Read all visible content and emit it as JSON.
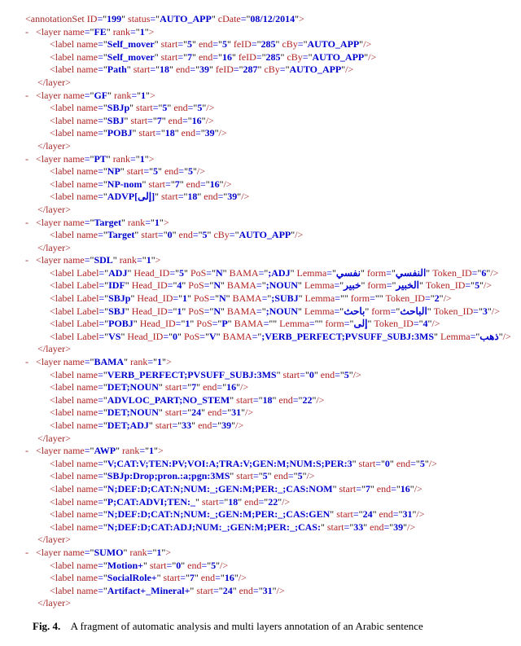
{
  "caption_label": "Fig. 4.",
  "caption_text": "A fragment of automatic analysis and multi layers annotation of an Arabic sentence",
  "annotationSet": {
    "ID": "199",
    "status": "AUTO_APP",
    "cDate": "08/12/2014"
  },
  "layers": [
    {
      "name": "FE",
      "rank": "1",
      "labels": [
        {
          "attrs": [
            [
              "name",
              "Self_mover"
            ],
            [
              "start",
              "5"
            ],
            [
              "end",
              "5"
            ],
            [
              "feID",
              "285"
            ],
            [
              "cBy",
              "AUTO_APP"
            ]
          ]
        },
        {
          "attrs": [
            [
              "name",
              "Self_mover"
            ],
            [
              "start",
              "7"
            ],
            [
              "end",
              "16"
            ],
            [
              "feID",
              "285"
            ],
            [
              "cBy",
              "AUTO_APP"
            ]
          ]
        },
        {
          "attrs": [
            [
              "name",
              "Path"
            ],
            [
              "start",
              "18"
            ],
            [
              "end",
              "39"
            ],
            [
              "feID",
              "287"
            ],
            [
              "cBy",
              "AUTO_APP"
            ]
          ]
        }
      ]
    },
    {
      "name": "GF",
      "rank": "1",
      "labels": [
        {
          "attrs": [
            [
              "name",
              "SBJp"
            ],
            [
              "start",
              "5"
            ],
            [
              "end",
              "5"
            ]
          ]
        },
        {
          "attrs": [
            [
              "name",
              "SBJ"
            ],
            [
              "start",
              "7"
            ],
            [
              "end",
              "16"
            ]
          ]
        },
        {
          "attrs": [
            [
              "name",
              "POBJ"
            ],
            [
              "start",
              "18"
            ],
            [
              "end",
              "39"
            ]
          ]
        }
      ]
    },
    {
      "name": "PT",
      "rank": "1",
      "labels": [
        {
          "attrs": [
            [
              "name",
              "NP"
            ],
            [
              "start",
              "5"
            ],
            [
              "end",
              "5"
            ]
          ]
        },
        {
          "attrs": [
            [
              "name",
              "NP-nom"
            ],
            [
              "start",
              "7"
            ],
            [
              "end",
              "16"
            ]
          ]
        },
        {
          "attrs": [
            [
              "name",
              "ADVP[إلى]"
            ],
            [
              "start",
              "18"
            ],
            [
              "end",
              "39"
            ]
          ]
        }
      ]
    },
    {
      "name": "Target",
      "rank": "1",
      "labels": [
        {
          "attrs": [
            [
              "name",
              "Target"
            ],
            [
              "start",
              "0"
            ],
            [
              "end",
              "5"
            ],
            [
              "cBy",
              "AUTO_APP"
            ]
          ]
        }
      ]
    },
    {
      "name": "SDL",
      "rank": "1",
      "labels": [
        {
          "attrs": [
            [
              "Label",
              "ADJ"
            ],
            [
              "Head_ID",
              "5"
            ],
            [
              "PoS",
              "N"
            ],
            [
              "BAMA",
              ";ADJ"
            ],
            [
              "Lemma",
              "نفسي"
            ],
            [
              "form",
              "النفسي"
            ],
            [
              "Token_ID",
              "6"
            ]
          ]
        },
        {
          "attrs": [
            [
              "Label",
              "IDF"
            ],
            [
              "Head_ID",
              "4"
            ],
            [
              "PoS",
              "N"
            ],
            [
              "BAMA",
              ";NOUN"
            ],
            [
              "Lemma",
              "خبير"
            ],
            [
              "form",
              "الخبير"
            ],
            [
              "Token_ID",
              "5"
            ]
          ]
        },
        {
          "attrs": [
            [
              "Label",
              "SBJp"
            ],
            [
              "Head_ID",
              "1"
            ],
            [
              "PoS",
              "N"
            ],
            [
              "BAMA",
              ";SUBJ"
            ],
            [
              "Lemma",
              ""
            ],
            [
              "form",
              ""
            ],
            [
              "Token_ID",
              "2"
            ]
          ]
        },
        {
          "attrs": [
            [
              "Label",
              "SBJ"
            ],
            [
              "Head_ID",
              "1"
            ],
            [
              "PoS",
              "N"
            ],
            [
              "BAMA",
              ";NOUN"
            ],
            [
              "Lemma",
              "باحث"
            ],
            [
              "form",
              "الباحث"
            ],
            [
              "Token_ID",
              "3"
            ]
          ]
        },
        {
          "attrs": [
            [
              "Label",
              "POBJ"
            ],
            [
              "Head_ID",
              "1"
            ],
            [
              "PoS",
              "P"
            ],
            [
              "BAMA",
              ""
            ],
            [
              "Lemma",
              ""
            ],
            [
              "form",
              "إلى"
            ],
            [
              "Token_ID",
              "4"
            ]
          ]
        },
        {
          "attrs": [
            [
              "Label",
              "VS"
            ],
            [
              "Head_ID",
              "0"
            ],
            [
              "PoS",
              "V"
            ],
            [
              "BAMA",
              ";VERB_PERFECT;PVSUFF_SUBJ:3MS"
            ],
            [
              "Lemma",
              "ذهب"
            ]
          ]
        }
      ]
    },
    {
      "name": "BAMA",
      "rank": "1",
      "labels": [
        {
          "attrs": [
            [
              "name",
              "VERB_PERFECT;PVSUFF_SUBJ:3MS"
            ],
            [
              "start",
              "0"
            ],
            [
              "end",
              "5"
            ]
          ]
        },
        {
          "attrs": [
            [
              "name",
              "DET;NOUN"
            ],
            [
              "start",
              "7"
            ],
            [
              "end",
              "16"
            ]
          ]
        },
        {
          "attrs": [
            [
              "name",
              "ADVLOC_PART;NO_STEM"
            ],
            [
              "start",
              "18"
            ],
            [
              "end",
              "22"
            ]
          ]
        },
        {
          "attrs": [
            [
              "name",
              "DET;NOUN"
            ],
            [
              "start",
              "24"
            ],
            [
              "end",
              "31"
            ]
          ]
        },
        {
          "attrs": [
            [
              "name",
              "DET;ADJ"
            ],
            [
              "start",
              "33"
            ],
            [
              "end",
              "39"
            ]
          ]
        }
      ]
    },
    {
      "name": "AWP",
      "rank": "1",
      "labels": [
        {
          "attrs": [
            [
              "name",
              "V;CAT:V;TEN:PV;VOI:A;TRA:V;GEN:M;NUM:S;PER:3"
            ],
            [
              "start",
              "0"
            ],
            [
              "end",
              "5"
            ]
          ]
        },
        {
          "attrs": [
            [
              "name",
              "SBJp:Drop;pron.:a;pgn:3MS"
            ],
            [
              "start",
              "5"
            ],
            [
              "end",
              "5"
            ]
          ]
        },
        {
          "attrs": [
            [
              "name",
              "N;DEF:D;CAT:N;NUM:_;GEN:M;PER:_;CAS:NOM"
            ],
            [
              "start",
              "7"
            ],
            [
              "end",
              "16"
            ]
          ]
        },
        {
          "attrs": [
            [
              "name",
              "P;CAT:ADVI;TEN:_"
            ],
            [
              "start",
              "18"
            ],
            [
              "end",
              "22"
            ]
          ]
        },
        {
          "attrs": [
            [
              "name",
              "N;DEF:D;CAT:N;NUM:_;GEN:M;PER:_;CAS:GEN"
            ],
            [
              "start",
              "24"
            ],
            [
              "end",
              "31"
            ]
          ]
        },
        {
          "attrs": [
            [
              "name",
              "N;DEF:D;CAT:ADJ;NUM:_;GEN:M;PER:_;CAS:"
            ],
            [
              "start",
              "33"
            ],
            [
              "end",
              "39"
            ]
          ]
        }
      ]
    },
    {
      "name": "SUMO",
      "rank": "1",
      "labels": [
        {
          "attrs": [
            [
              "name",
              "Motion+"
            ],
            [
              "start",
              "0"
            ],
            [
              "end",
              "5"
            ]
          ]
        },
        {
          "attrs": [
            [
              "name",
              "SocialRole+"
            ],
            [
              "start",
              "7"
            ],
            [
              "end",
              "16"
            ]
          ]
        },
        {
          "attrs": [
            [
              "name",
              "Artifact+_Mineral+"
            ],
            [
              "start",
              "24"
            ],
            [
              "end",
              "31"
            ]
          ]
        }
      ]
    }
  ]
}
